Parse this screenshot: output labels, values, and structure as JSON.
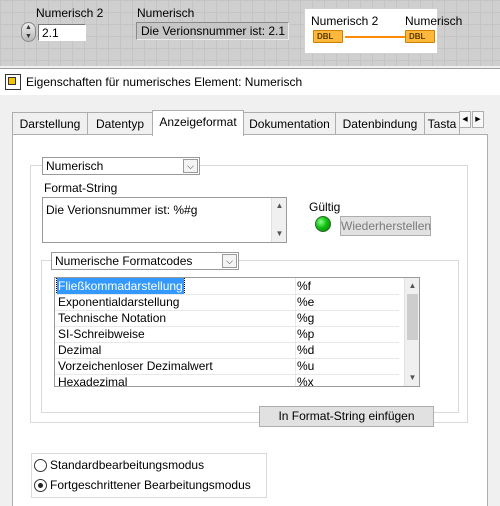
{
  "front_panel": {
    "control_label": "Numerisch 2",
    "control_value": "2.1",
    "indicator_label": "Numerisch",
    "indicator_value": "Die Verionsnummer ist: 2.1",
    "block_diagram": {
      "left_label": "Numerisch 2",
      "right_label": "Numerisch",
      "left_terminal": "DBL",
      "right_terminal": "DBL"
    }
  },
  "dialog": {
    "title": "Eigenschaften für numerisches Element: Numerisch",
    "tabs": [
      "Darstellung",
      "Datentyp",
      "Anzeigeformat",
      "Dokumentation",
      "Datenbindung",
      "Tasta"
    ],
    "active_tab": "Anzeigeformat",
    "type_select": "Numerisch",
    "format_string_label": "Format-String",
    "format_string_value": "Die Verionsnummer ist: %#g",
    "valid_label": "Gültig",
    "restore_button": "Wiederherstellen",
    "codes_select": "Numerische Formatcodes",
    "codes": [
      {
        "name": "Fließkommadarstellung",
        "code": "%f"
      },
      {
        "name": "Exponentialdarstellung",
        "code": "%e"
      },
      {
        "name": "Technische Notation",
        "code": "%g"
      },
      {
        "name": "SI-Schreibweise",
        "code": "%p"
      },
      {
        "name": "Dezimal",
        "code": "%d"
      },
      {
        "name": "Vorzeichenloser Dezimalwert",
        "code": "%u"
      },
      {
        "name": "Hexadezimal",
        "code": "%x"
      }
    ],
    "insert_button": "In Format-String einfügen",
    "mode_standard": "Standardbearbeitungsmodus",
    "mode_advanced": "Fortgeschrittener Bearbeitungsmodus"
  },
  "colors": {
    "selection": "#3399ff",
    "valid_led": "#10c010",
    "dbl_terminal": "#ffb83c"
  }
}
